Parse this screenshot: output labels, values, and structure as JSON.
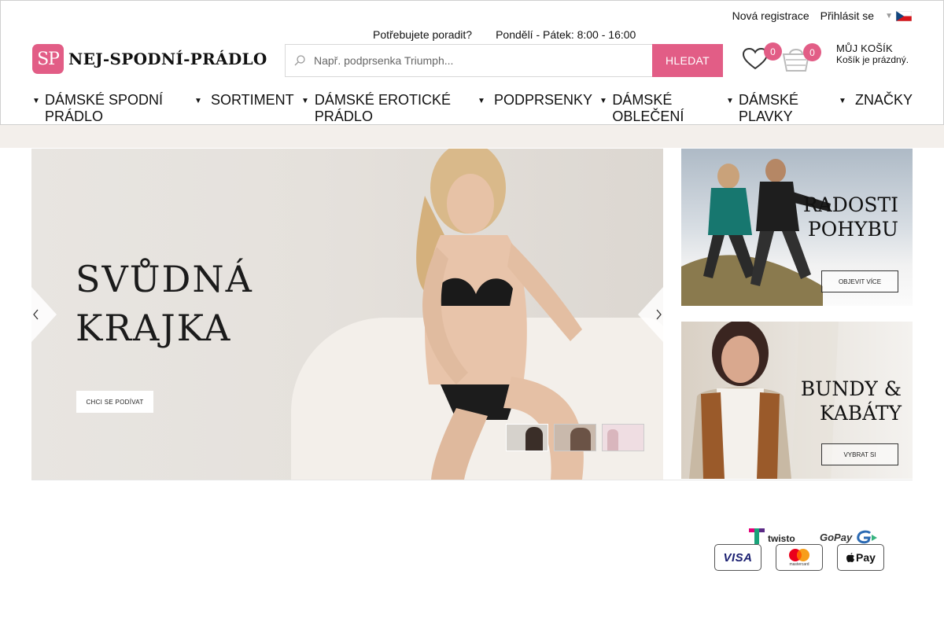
{
  "header": {
    "top_links": {
      "register": "Nová registrace",
      "login": "Přihlásit se",
      "language": "cs"
    },
    "help": {
      "question": "Potřebujete poradit?",
      "hours": "Pondělí - Pátek: 8:00 - 16:00"
    },
    "logo": {
      "initials": "SP",
      "text": "NEJ-SPODNÍ-PRÁDLO"
    },
    "search": {
      "placeholder": "Např. podprsenka Triumph...",
      "button": "HLEDAT",
      "icon": "search-icon"
    },
    "wishlist": {
      "count": "0",
      "icon": "heart-icon"
    },
    "cart": {
      "count": "0",
      "title": "MŮJ KOŠÍK",
      "subtitle": "Košík je prázdný.",
      "icon": "basket-icon"
    }
  },
  "nav": [
    {
      "label": "DÁMSKÉ SPODNÍ PRÁDLO"
    },
    {
      "label": "SORTIMENT"
    },
    {
      "label": "DÁMSKÉ EROTICKÉ PRÁDLO"
    },
    {
      "label": "PODPRSENKY"
    },
    {
      "label": "DÁMSKÉ OBLEČENÍ"
    },
    {
      "label": "DÁMSKÉ PLAVKY"
    },
    {
      "label": "ZNAČKY"
    }
  ],
  "hero": {
    "title_line1": "SVŮDNÁ",
    "title_line2": "KRAJKA",
    "button": "CHCI SE PODÍVAT",
    "slide_count": 3,
    "active_slide": 1
  },
  "promos": [
    {
      "title_line1": "RADOSTI",
      "title_line2": "POHYBU",
      "button": "OBJEVIT VÍCE"
    },
    {
      "title_line1": "BUNDY &",
      "title_line2": "KABÁTY",
      "button": "VYBRAT SI"
    }
  ],
  "payments": {
    "twisto": "twisto",
    "gopay": "GoPay",
    "visa": "VISA",
    "mastercard": "mastercard",
    "applepay": "Pay"
  },
  "colors": {
    "accent": "#e25d86",
    "strip": "#f3efeb"
  }
}
